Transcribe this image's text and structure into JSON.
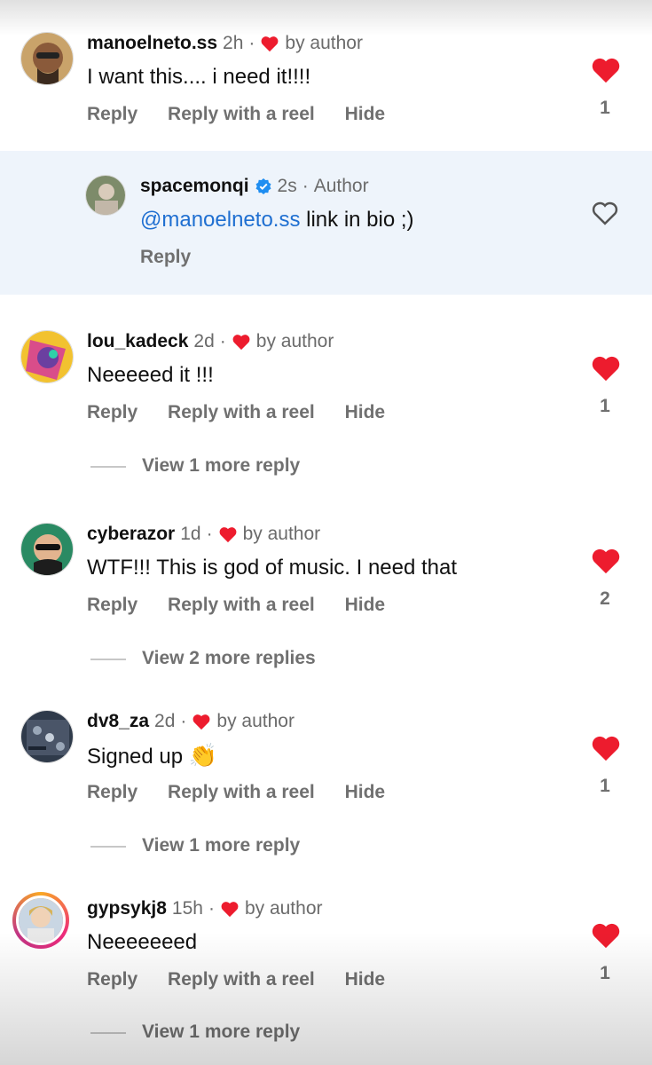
{
  "colors": {
    "accent_blue": "#1f6fd1",
    "heart_red": "#ed1c2e",
    "muted_gray": "#707070",
    "reply_bg": "#eef4fb"
  },
  "icons": {
    "liked": "heart-filled-icon",
    "unliked": "heart-outline-icon",
    "verified": "verified-badge-icon",
    "small_heart": "heart-small-icon"
  },
  "labels": {
    "reply": "Reply",
    "reply_reel": "Reply with a reel",
    "hide": "Hide",
    "by_author": "by author",
    "dot": "·"
  },
  "comments": [
    {
      "username": "manoelneto.ss",
      "time": "2h",
      "text": "I want this.... i need it!!!!",
      "likes": "1"
    },
    {
      "username": "lou_kadeck",
      "time": "2d",
      "text": "Neeeeed it !!!",
      "likes": "1",
      "view_more": "View 1 more reply"
    },
    {
      "username": "cyberazor",
      "time": "1d",
      "text": "WTF!!! This is god of music. I need that",
      "likes": "2",
      "view_more": "View 2 more replies"
    },
    {
      "username": "dv8_za",
      "time": "2d",
      "text": "Signed up",
      "emoji": "👏",
      "likes": "1",
      "view_more": "View 1 more reply"
    },
    {
      "username": "gypsykj8",
      "time": "15h",
      "text": "Neeeeeeed",
      "likes": "1",
      "view_more": "View 1 more reply"
    }
  ],
  "author_reply": {
    "username": "spacemonqi",
    "time": "2s",
    "role": "Author",
    "mention": "@manoelneto.ss",
    "text": " link in bio ;)",
    "reply": "Reply"
  }
}
